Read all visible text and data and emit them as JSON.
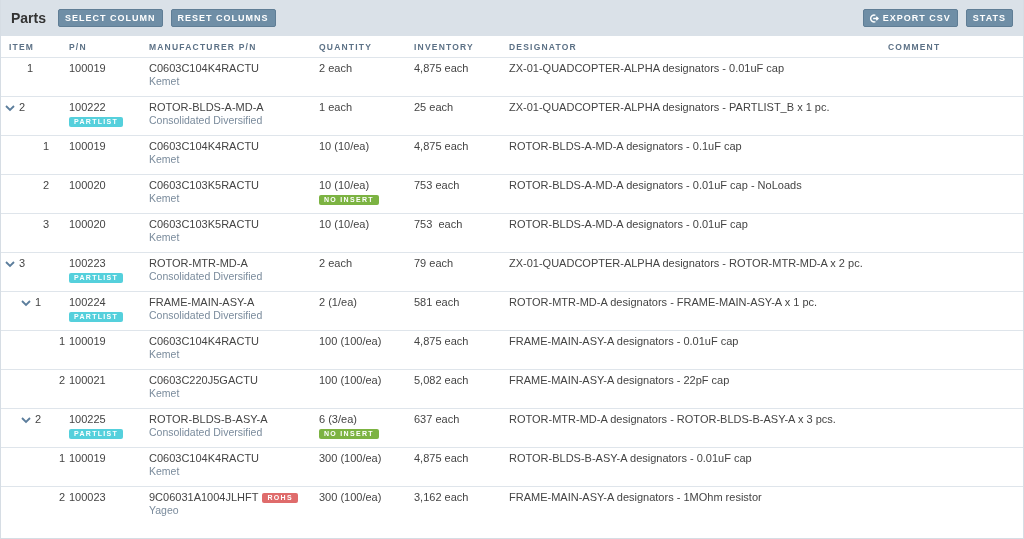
{
  "header": {
    "title": "Parts",
    "left_buttons": [
      "SELECT COLUMN",
      "RESET COLUMNS"
    ],
    "right_buttons": [
      {
        "label": "EXPORT CSV",
        "kind": "export"
      },
      {
        "label": "STATS",
        "kind": "plain"
      }
    ]
  },
  "table": {
    "columns": [
      "ITEM",
      "P/N",
      "MANUFACTURER P/N",
      "QUANTITY",
      "INVENTORY",
      "DESIGNATOR",
      "COMMENT"
    ],
    "rows": [
      {
        "item": "1",
        "pn": "100019",
        "mpn": "C0603C104K4RACTU",
        "manufacturer": "Kemet",
        "quantity": "2 each",
        "inventory": "4,875 each",
        "designator": "ZX-01-QUADCOPTER-ALPHA designators - 0.01uF cap"
      },
      {
        "item": "2",
        "expanded": true,
        "pn": "100222",
        "pn_tag": "PARTLIST",
        "mpn": "ROTOR-BLDS-A-MD-A",
        "manufacturer": "Consolidated Diversified",
        "quantity": "1 each",
        "inventory": "25 each",
        "designator": "ZX-01-QUADCOPTER-ALPHA designators - PARTLIST_B x 1 pc.",
        "children": [
          {
            "item": "1",
            "pn": "100019",
            "mpn": "C0603C104K4RACTU",
            "manufacturer": "Kemet",
            "quantity": "10 (10/ea)",
            "inventory": "4,875 each",
            "designator": "ROTOR-BLDS-A-MD-A designators - 0.1uF cap"
          },
          {
            "item": "2",
            "pn": "100020",
            "mpn": "C0603C103K5RACTU",
            "manufacturer": "Kemet",
            "quantity": "10 (10/ea)",
            "quantity_tag": "NO INSERT",
            "inventory": "753 each",
            "designator": "ROTOR-BLDS-A-MD-A designators - 0.01uF cap - NoLoads"
          },
          {
            "item": "3",
            "pn": "100020",
            "mpn": "C0603C103K5RACTU",
            "manufacturer": "Kemet",
            "quantity": "10 (10/ea)",
            "inventory": "753  each",
            "designator": "ROTOR-BLDS-A-MD-A designators - 0.01uF cap"
          }
        ]
      },
      {
        "item": "3",
        "expanded": true,
        "pn": "100223",
        "pn_tag": "PARTLIST",
        "mpn": "ROTOR-MTR-MD-A",
        "manufacturer": "Consolidated Diversified",
        "quantity": "2 each",
        "inventory": "79 each",
        "designator": "ZX-01-QUADCOPTER-ALPHA designators - ROTOR-MTR-MD-A x 2 pc.",
        "children": [
          {
            "item": "1",
            "expanded": true,
            "pn": "100224",
            "pn_tag": "PARTLIST",
            "mpn": "FRAME-MAIN-ASY-A",
            "manufacturer": "Consolidated Diversified",
            "quantity": "2 (1/ea)",
            "inventory": "581 each",
            "designator": "ROTOR-MTR-MD-A designators - FRAME-MAIN-ASY-A x 1 pc.",
            "children": [
              {
                "item": "1",
                "pn": "100019",
                "mpn": "C0603C104K4RACTU",
                "manufacturer": "Kemet",
                "quantity": "100 (100/ea)",
                "inventory": "4,875 each",
                "designator": "FRAME-MAIN-ASY-A designators - 0.01uF cap"
              },
              {
                "item": "2",
                "pn": "100021",
                "mpn": "C0603C220J5GACTU",
                "manufacturer": "Kemet",
                "quantity": "100 (100/ea)",
                "inventory": "5,082 each",
                "designator": "FRAME-MAIN-ASY-A designators - 22pF cap"
              }
            ]
          },
          {
            "item": "2",
            "expanded": true,
            "pn": "100225",
            "pn_tag": "PARTLIST",
            "mpn": "ROTOR-BLDS-B-ASY-A",
            "manufacturer": "Consolidated Diversified",
            "quantity": "6 (3/ea)",
            "quantity_tag": "NO INSERT",
            "inventory": "637 each",
            "designator": "ROTOR-MTR-MD-A designators - ROTOR-BLDS-B-ASY-A x 3 pcs.",
            "children": [
              {
                "item": "1",
                "pn": "100019",
                "mpn": "C0603C104K4RACTU",
                "manufacturer": "Kemet",
                "quantity": "300 (100/ea)",
                "inventory": "4,875 each",
                "designator": "ROTOR-BLDS-B-ASY-A designators - 0.01uF cap"
              },
              {
                "item": "2",
                "pn": "100023",
                "mpn": "9C06031A1004JLHFT",
                "mpn_tag": "ROHS",
                "manufacturer": "Yageo",
                "quantity": "300 (100/ea)",
                "inventory": "3,162 each",
                "designator": "FRAME-MAIN-ASY-A designators - 1MOhm resistor"
              }
            ]
          }
        ]
      }
    ]
  }
}
